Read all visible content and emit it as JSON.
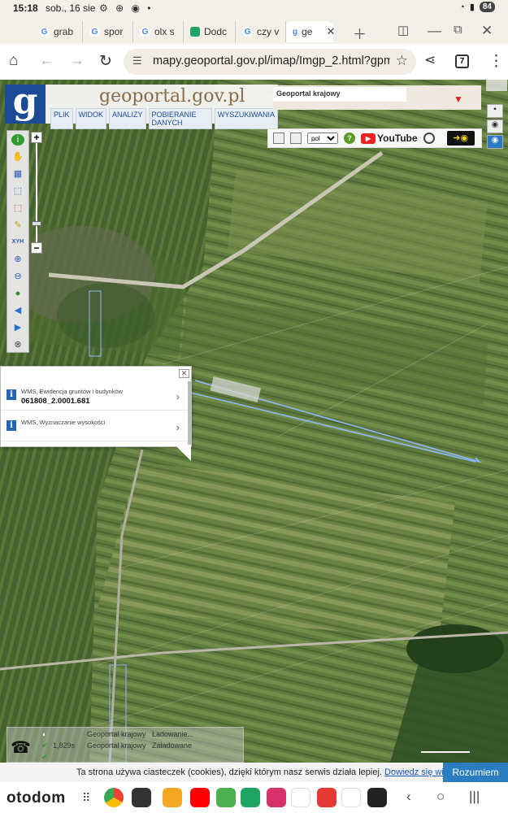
{
  "status_bar": {
    "time": "15:18",
    "date": "sob., 16 sie",
    "icons": "⚙ ⊕ ◉ •",
    "signal": "WiFi ▮▮▮",
    "battery": "84"
  },
  "tabs": [
    {
      "label": "grab",
      "icon": "google-icon"
    },
    {
      "label": "spor",
      "icon": "google-icon"
    },
    {
      "label": "olx s",
      "icon": "google-icon"
    },
    {
      "label": "Dodc",
      "icon": "green-app-icon"
    },
    {
      "label": "czy v",
      "icon": "google-icon"
    },
    {
      "label": "ge",
      "icon": "geoportal-icon",
      "active": true
    }
  ],
  "address_bar": {
    "url": "mapy.geoportal.gov.pl/imap/Imgp_2.html?gpm",
    "tab_count": "7"
  },
  "geoportal": {
    "logo_letter": "g",
    "site_title": "geoportal.gov.pl",
    "menu": [
      "PLIK",
      "WIDOK",
      "ANALIZY",
      "POBIERANIE DANYCH",
      "WYSZUKIWANIA"
    ],
    "overview_label": "Geoportal krajowy",
    "language": "pol",
    "youtube_label": "YouTube"
  },
  "popup": {
    "rows": [
      {
        "layer": "WMS, Ewidencja gruntów i budynków",
        "value": "061808_2.0001.681"
      },
      {
        "layer": "WMS, Wyznaczanie wysokości",
        "value": ""
      }
    ]
  },
  "load_status": {
    "rows": [
      {
        "time": "",
        "source": "Geoportal krajowy",
        "state": "Ładowanie..."
      },
      {
        "time": "1,829s",
        "source": "Geoportal krajowy",
        "state": "Załadowane"
      }
    ]
  },
  "cookie_bar": {
    "text": "Ta strona używa ciasteczek (cookies), dzięki którym nasz serwis działa lepiej.",
    "link": "Dowiedz się więcej",
    "button": "Rozumiem"
  },
  "nav_bar": {
    "brand": "otodom"
  },
  "colors": {
    "geoportal_blue": "#1b4b95",
    "accent": "#2a7dbf",
    "parcel_line": "#9fc3ff"
  }
}
